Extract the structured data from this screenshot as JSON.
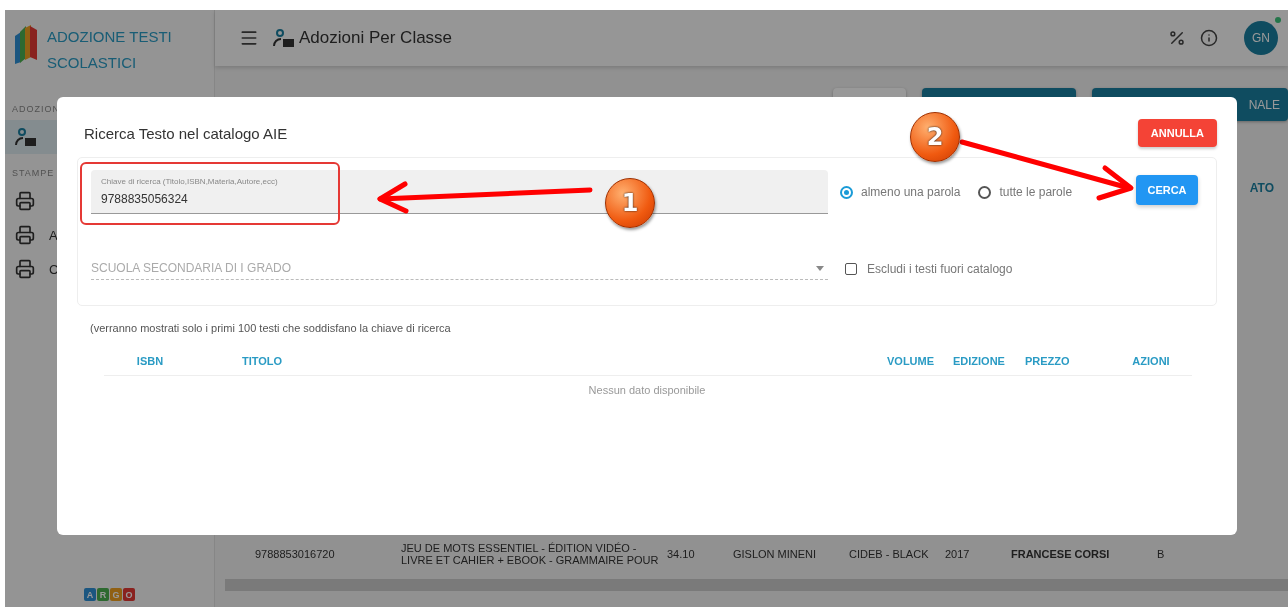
{
  "app": {
    "title": "ADOZIONE TESTI SCOLASTICI",
    "page_title": "Adozioni Per Classe",
    "avatar": "GN",
    "online": true
  },
  "logo_letters": [
    "A",
    "R",
    "G",
    "O"
  ],
  "sidebar": {
    "sections": [
      {
        "label": "ADOZION",
        "items": [
          {
            "kind": "reader",
            "selected": true
          }
        ]
      },
      {
        "label": "STAMPE",
        "items": [
          {
            "kind": "printer",
            "selected": false
          },
          {
            "kind": "printer",
            "label": "A",
            "selected": false
          },
          {
            "kind": "printer",
            "label": "C",
            "selected": false
          }
        ]
      }
    ]
  },
  "background": {
    "buttons": [
      {
        "kind": "light"
      },
      {
        "kind": "teal"
      },
      {
        "kind": "teal",
        "label": "NALE"
      }
    ],
    "column_header": "ATO",
    "row": {
      "isbn": "9788853016720",
      "title": "JEU DE MOTS ESSENTIEL - ÉDITION VIDÉO - LIVRE ET CAHIER + EBOOK - GRAMMAIRE POUR",
      "price": "34.10",
      "author": "GISLON MINENI",
      "publisher": "CIDEB - BLACK",
      "year": "2017",
      "subject": "FRANCESE CORSI",
      "column_8": "B"
    }
  },
  "dialog": {
    "title": "Ricerca Testo nel catalogo AIE",
    "cancel": "ANNULLA",
    "search_field": {
      "label": "Chiave di ricerca (Titolo,ISBN,Materia,Autore,ecc)",
      "value": "9788835056324"
    },
    "match_options": [
      {
        "label": "almeno una parola",
        "selected": true
      },
      {
        "label": "tutte le parole",
        "selected": false
      }
    ],
    "search_button": "CERCA",
    "school_select": {
      "placeholder": "SCUOLA SECONDARIA DI I GRADO"
    },
    "exclude_checkbox": {
      "label": "Escludi i testi fuori catalogo",
      "checked": false
    },
    "note": "(verranno mostrati solo i primi 100 testi che soddisfano la chiave di ricerca",
    "columns": [
      "ISBN",
      "TITOLO",
      "VOLUME",
      "EDIZIONE",
      "PREZZO",
      "AZIONI"
    ],
    "empty": "Nessun dato disponibile"
  },
  "annotations": [
    {
      "label": "1"
    },
    {
      "label": "2"
    }
  ]
}
